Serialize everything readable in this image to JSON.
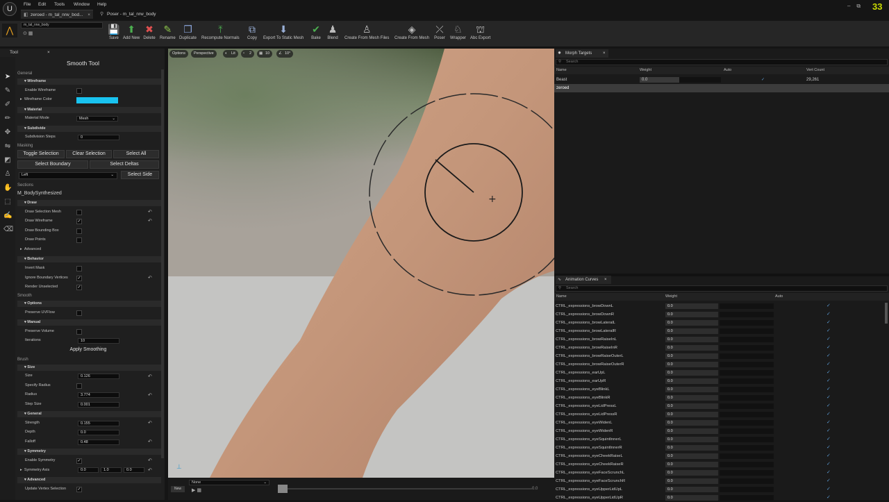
{
  "menu": {
    "items": [
      "File",
      "Edit",
      "Tools",
      "Window",
      "Help"
    ]
  },
  "tabs": [
    {
      "label": "zeroed - m_tal_nrw_bod...",
      "close": "×"
    },
    {
      "label": "Poser - m_tal_nrw_body"
    }
  ],
  "fps": "33",
  "toolbar": {
    "asset": "m_tal_nrw_body",
    "buttons": [
      {
        "label": "Save",
        "icon": "save-icon",
        "glyph": "💾",
        "color": "#cfcfcf"
      },
      {
        "label": "Add New",
        "icon": "add-icon",
        "glyph": "⬆",
        "color": "#4caf50"
      },
      {
        "label": "Delete",
        "icon": "delete-icon",
        "glyph": "✖",
        "color": "#e05050"
      },
      {
        "label": "Rename",
        "icon": "rename-icon",
        "glyph": "✎",
        "color": "#8bc34a"
      },
      {
        "label": "Duplicate",
        "icon": "duplicate-icon",
        "glyph": "❐",
        "color": "#8aa4d8"
      },
      {
        "label": "Recompute Normals",
        "icon": "normals-icon",
        "glyph": "⤒",
        "color": "#4caf50"
      },
      {
        "label": "Copy",
        "icon": "copy-icon",
        "glyph": "⧉",
        "color": "#9ab0d8"
      },
      {
        "label": "Export To Static Mesh",
        "icon": "export-icon",
        "glyph": "⬇",
        "color": "#9ab0d8"
      },
      {
        "label": "Bake",
        "icon": "bake-icon",
        "glyph": "✔",
        "color": "#4caf50"
      },
      {
        "label": "Blend",
        "icon": "blend-icon",
        "glyph": "♟",
        "color": "#bbb"
      },
      {
        "label": "Create From Mesh Files",
        "icon": "mesh-files-icon",
        "glyph": "♙",
        "color": "#bbb"
      },
      {
        "label": "Create From Mesh",
        "icon": "create-mesh-icon",
        "glyph": "◈",
        "color": "#bbb"
      },
      {
        "label": "Poser",
        "icon": "poser-icon",
        "glyph": "⤫",
        "color": "#bbb"
      },
      {
        "label": "Wrapper",
        "icon": "wrapper-icon",
        "glyph": "♘",
        "color": "#bbb"
      },
      {
        "label": "Abc Export",
        "icon": "abc-export-icon",
        "glyph": "⛫",
        "color": "#bbb"
      }
    ]
  },
  "tool": {
    "panel_tab": "Tool",
    "title": "Smooth Tool",
    "general": "General",
    "wireframe": {
      "group": "Wireframe",
      "enable": "Enable Wireframe",
      "color_label": "Wireframe Color",
      "color": "#19c3f0"
    },
    "material": {
      "group": "Material",
      "mode_label": "Material Mode",
      "mode_value": "Mesh"
    },
    "subdivide": {
      "group": "Subdivide",
      "steps_label": "Subdivision Steps",
      "steps_value": "0"
    },
    "masking": {
      "label": "Masking",
      "toggle": "Toggle Selection",
      "clear": "Clear Selection",
      "select_all": "Select All",
      "select_boundary": "Select Boundary",
      "select_deltas": "Select Deltas",
      "side_value": "Left",
      "select_side": "Select Side"
    },
    "sections": {
      "label": "Sections",
      "item": "M_BodySynthesized"
    },
    "draw": {
      "group": "Draw",
      "mesh": "Draw Selection Mesh",
      "wire": "Draw Wireframe",
      "bbox": "Draw Bounding Box",
      "points": "Draw Points",
      "advanced": "Advanced"
    },
    "behavior": {
      "group": "Behavior",
      "invert": "Invert Mask",
      "ignore": "Ignore Boundary Vertices",
      "render": "Render Unselected"
    },
    "smooth": {
      "label": "Smooth",
      "options": "Options",
      "uvflow": "Preserve UVFlow",
      "manual": "Manual",
      "volume": "Preserve Volume",
      "iter_label": "Iterations",
      "iter_value": "10",
      "apply": "Apply Smoothing"
    },
    "brush": {
      "label": "Brush",
      "size_group": "Size",
      "size_label": "Size",
      "size_value": "0.126",
      "radius_label": "Specify Radius",
      "r_label": "Radius",
      "r_value": "3.774",
      "step_label": "Step Size",
      "step_value": "0.001",
      "general": "General",
      "strength_label": "Strength",
      "strength_value": "0.155",
      "depth_label": "Depth",
      "depth_value": "0.0",
      "falloff_label": "Falloff",
      "falloff_value": "0.48"
    },
    "symmetry": {
      "group": "Symmetry",
      "enable": "Enable Symmetry",
      "axis_label": "Symmetry Axis",
      "x": "0.0",
      "y": "1.0",
      "z": "0.0"
    },
    "advanced": {
      "group": "Advanced",
      "update": "Update Vertex Selection"
    }
  },
  "viewport": {
    "options": "Options",
    "perspective": "Perspective",
    "lit": "Lit",
    "n1": "2",
    "n2": "10",
    "angle": "10°"
  },
  "bottom": {
    "dropdown": "None",
    "new": "New",
    "time": "0.0"
  },
  "morph": {
    "tab": "Morph Targets",
    "search": "Search",
    "cols": {
      "name": "Name",
      "weight": "Weight",
      "auto": "Auto",
      "count": "Vert Count"
    },
    "rows": [
      {
        "name": "Beast",
        "weight": "0.0",
        "count": "29,261"
      },
      {
        "name": "zeroed",
        "weight": "",
        "count": ""
      }
    ]
  },
  "curves": {
    "tab": "Animation Curves",
    "search": "Search",
    "cols": {
      "name": "Name",
      "weight": "Weight",
      "auto": "Auto"
    },
    "rows": [
      {
        "name": "CTRL_expressions_browDownL",
        "weight": "0.0"
      },
      {
        "name": "CTRL_expressions_browDownR",
        "weight": "0.0"
      },
      {
        "name": "CTRL_expressions_browLateralL",
        "weight": "0.0"
      },
      {
        "name": "CTRL_expressions_browLateralR",
        "weight": "0.0"
      },
      {
        "name": "CTRL_expressions_browRaiseInL",
        "weight": "0.0"
      },
      {
        "name": "CTRL_expressions_browRaiseInR",
        "weight": "0.0"
      },
      {
        "name": "CTRL_expressions_browRaiseOuterL",
        "weight": "0.0"
      },
      {
        "name": "CTRL_expressions_browRaiseOuterR",
        "weight": "0.0"
      },
      {
        "name": "CTRL_expressions_earUpL",
        "weight": "0.0"
      },
      {
        "name": "CTRL_expressions_earUpR",
        "weight": "0.0"
      },
      {
        "name": "CTRL_expressions_eyeBlinkL",
        "weight": "0.0"
      },
      {
        "name": "CTRL_expressions_eyeBlinkR",
        "weight": "0.0"
      },
      {
        "name": "CTRL_expressions_eyeLidPressL",
        "weight": "0.0"
      },
      {
        "name": "CTRL_expressions_eyeLidPressR",
        "weight": "0.0"
      },
      {
        "name": "CTRL_expressions_eyeWidenL",
        "weight": "0.0"
      },
      {
        "name": "CTRL_expressions_eyeWidenR",
        "weight": "0.0"
      },
      {
        "name": "CTRL_expressions_eyeSquintInnerL",
        "weight": "0.0"
      },
      {
        "name": "CTRL_expressions_eyeSquintInnerR",
        "weight": "0.0"
      },
      {
        "name": "CTRL_expressions_eyeCheekRaiseL",
        "weight": "0.0"
      },
      {
        "name": "CTRL_expressions_eyeCheekRaiseR",
        "weight": "0.0"
      },
      {
        "name": "CTRL_expressions_eyeFaceScrunchL",
        "weight": "0.0"
      },
      {
        "name": "CTRL_expressions_eyeFaceScrunchR",
        "weight": "0.0"
      },
      {
        "name": "CTRL_expressions_eyeUpperLidUpL",
        "weight": "0.0"
      },
      {
        "name": "CTRL_expressions_eyeUpperLidUpR",
        "weight": "0.0"
      }
    ]
  }
}
